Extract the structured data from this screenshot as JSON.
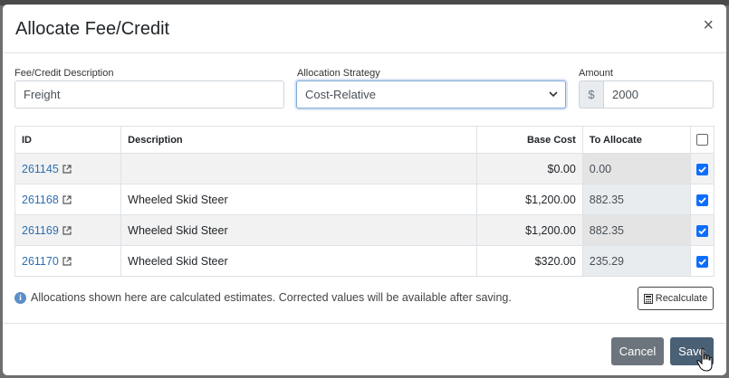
{
  "modal": {
    "title": "Allocate Fee/Credit",
    "close_glyph": "×"
  },
  "form": {
    "description_label": "Fee/Credit Description",
    "description_value": "Freight",
    "strategy_label": "Allocation Strategy",
    "strategy_value": "Cost-Relative",
    "amount_label": "Amount",
    "amount_prefix": "$",
    "amount_value": "2000"
  },
  "table": {
    "headers": {
      "id": "ID",
      "description": "Description",
      "base_cost": "Base Cost",
      "to_allocate": "To Allocate"
    },
    "header_checkbox_checked": false,
    "rows": [
      {
        "id": "261145",
        "description": "",
        "base_cost": "$0.00",
        "to_allocate": "0.00",
        "checked": true
      },
      {
        "id": "261168",
        "description": "Wheeled Skid Steer",
        "base_cost": "$1,200.00",
        "to_allocate": "882.35",
        "checked": true
      },
      {
        "id": "261169",
        "description": "Wheeled Skid Steer",
        "base_cost": "$1,200.00",
        "to_allocate": "882.35",
        "checked": true
      },
      {
        "id": "261170",
        "description": "Wheeled Skid Steer",
        "base_cost": "$320.00",
        "to_allocate": "235.29",
        "checked": true
      }
    ]
  },
  "notice": {
    "icon": "info-icon",
    "text": "Allocations shown here are calculated estimates. Corrected values will be available after saving."
  },
  "buttons": {
    "recalculate": "Recalculate",
    "cancel": "Cancel",
    "save": "Save"
  },
  "colors": {
    "link": "#2d6fb0",
    "checkbox": "#0d6efd",
    "cancel": "#6c757d",
    "save": "#4a6075"
  }
}
